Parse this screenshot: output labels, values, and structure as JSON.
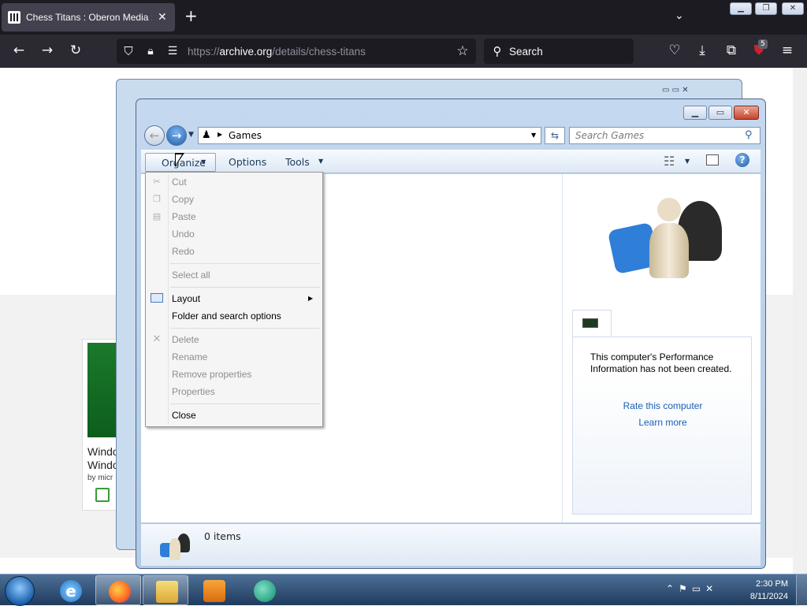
{
  "browser": {
    "tab_title": "Chess Titans : Oberon Media : F",
    "tab_close": "✕",
    "new_tab": "+",
    "url_prefix": "https://",
    "url_domain": "archive.org",
    "url_path": "/details/chess-titans",
    "search_placeholder": "Search",
    "extension_badge": "5"
  },
  "webpage": {
    "card_title": "Windo Windo",
    "card_by": "by micr"
  },
  "explorer": {
    "breadcrumb": "Games",
    "search_placeholder": "Search Games",
    "commands": {
      "organize": "Organize",
      "options": "Options",
      "tools": "Tools"
    },
    "item_count": "0 items",
    "perf_message": "This computer's Performance Information has not been created.",
    "rate_link": "Rate this computer",
    "learn_link": "Learn more"
  },
  "menu": {
    "cut": "Cut",
    "copy": "Copy",
    "paste": "Paste",
    "undo": "Undo",
    "redo": "Redo",
    "select_all": "Select all",
    "layout": "Layout",
    "folder_options": "Folder and search options",
    "delete": "Delete",
    "rename": "Rename",
    "remove_properties": "Remove properties",
    "properties": "Properties",
    "close": "Close"
  },
  "taskbar": {
    "time": "2:30 PM",
    "date": "8/11/2024"
  },
  "colors": {
    "ff_dark": "#1c1b22",
    "win_frame": "#b3cbe6",
    "link": "#1a5fb4",
    "taskbar": "#1f3b5e"
  }
}
